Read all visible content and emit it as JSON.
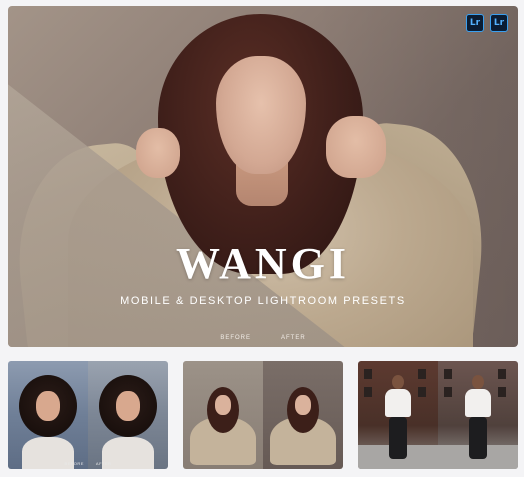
{
  "hero": {
    "title": "WANGI",
    "subtitle": "MOBILE & DESKTOP LIGHTROOM PRESETS",
    "before_label": "BEFORE",
    "after_label": "AFTER",
    "badges": [
      {
        "label": "Lr",
        "icon": "lightroom-mobile-icon"
      },
      {
        "label": "Lr",
        "icon": "lightroom-desktop-icon"
      }
    ]
  },
  "thumbnails": [
    {
      "before_label": "BEFORE",
      "after_label": "AFTER"
    },
    {
      "before_label": "",
      "after_label": ""
    },
    {
      "before_label": "",
      "after_label": ""
    }
  ],
  "colors": {
    "background": "#f4f4f6",
    "title_text": "#ffffff",
    "lr_badge_bg": "#0b1d33",
    "lr_badge_text": "#53b2ff"
  }
}
